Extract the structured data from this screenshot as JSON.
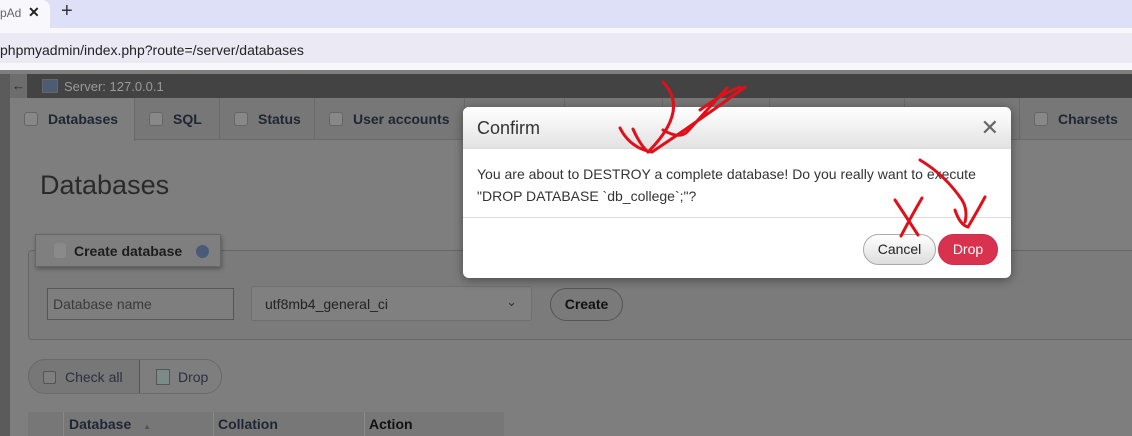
{
  "browser": {
    "tab_title": "pAd",
    "new_tab": "+",
    "close": "✕",
    "url": "phpmyadmin/index.php?route=/server/databases"
  },
  "server": {
    "back": "←",
    "label": "Server: 127.0.0.1"
  },
  "tabs": [
    {
      "label": "Databases"
    },
    {
      "label": "SQL"
    },
    {
      "label": "Status"
    },
    {
      "label": "User accounts"
    },
    {
      "label": "Charsets"
    }
  ],
  "page": {
    "title": "Databases"
  },
  "create": {
    "legend": "Create database",
    "name_placeholder": "Database name",
    "collation": "utf8mb4_general_ci",
    "button": "Create"
  },
  "bulk": {
    "check_all": "Check all",
    "drop": "Drop"
  },
  "table": {
    "headers": [
      "Database",
      "Collation",
      "Action"
    ],
    "sort": "▲"
  },
  "dialog": {
    "title": "Confirm",
    "message_line1": "You are about to DESTROY a complete database! Do you really want to execute",
    "message_line2": "\"DROP DATABASE `db_college`;\"?",
    "cancel": "Cancel",
    "drop": "Drop"
  },
  "colors": {
    "danger": "#d9324f",
    "annotation": "#e0101a"
  }
}
